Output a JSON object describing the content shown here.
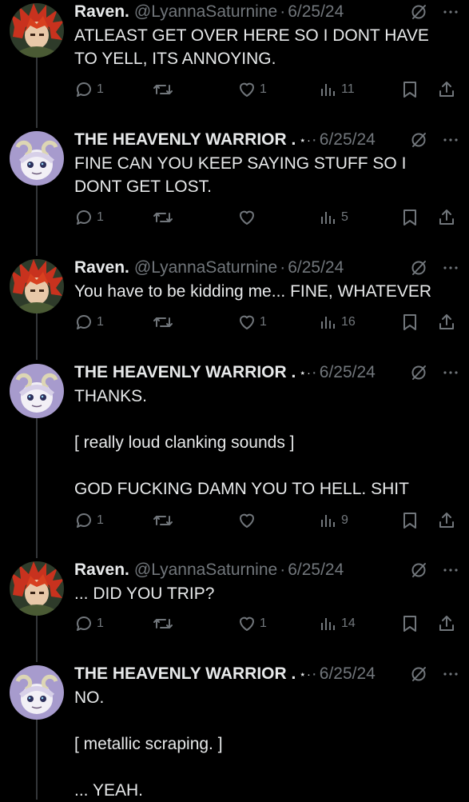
{
  "tweets": [
    {
      "name": "Raven.",
      "badge": "",
      "handle": "@LyannaSaturnine",
      "date": "6/25/24",
      "text": "ATLEAST GET OVER HERE SO I DONT HAVE\nTO YELL, ITS ANNOYING.",
      "replies": "1",
      "retweets": "",
      "likes": "1",
      "views": "11",
      "avatar": "red-hair"
    },
    {
      "name": "THE HEAVENLY WARRIOR .",
      "badge": "⋆·",
      "handle": "",
      "date": "6/25/24",
      "text": "FINE CAN YOU KEEP SAYING STUFF SO I\nDONT GET LOST.",
      "replies": "1",
      "retweets": "",
      "likes": "",
      "views": "5",
      "avatar": "ram-horns"
    },
    {
      "name": "Raven.",
      "badge": "",
      "handle": "@LyannaSaturnine",
      "date": "6/25/24",
      "text": "You have to be kidding me... FINE, WHATEVER",
      "replies": "1",
      "retweets": "",
      "likes": "1",
      "views": "16",
      "avatar": "red-hair"
    },
    {
      "name": "THE HEAVENLY WARRIOR .",
      "badge": "⋆·",
      "handle": "",
      "date": "6/25/24",
      "text": "THANKS.\n\n[ really loud clanking sounds ]\n\nGOD FUCKING DAMN YOU TO HELL. SHIT",
      "replies": "1",
      "retweets": "",
      "likes": "",
      "views": "9",
      "avatar": "ram-horns"
    },
    {
      "name": "Raven.",
      "badge": "",
      "handle": "@LyannaSaturnine",
      "date": "6/25/24",
      "text": "... DID YOU TRIP?",
      "replies": "1",
      "retweets": "",
      "likes": "1",
      "views": "14",
      "avatar": "red-hair"
    },
    {
      "name": "THE HEAVENLY WARRIOR .",
      "badge": "⋆·",
      "handle": "",
      "date": "6/25/24",
      "text": "NO.\n\n[ metallic scraping. ]\n\n... YEAH.",
      "replies": "",
      "retweets": "",
      "likes": "",
      "views": "",
      "avatar": "ram-horns"
    }
  ],
  "icons": {
    "meta_separator": "·",
    "grok": "grok-icon",
    "more": "more-icon",
    "reply": "reply-icon",
    "retweet": "retweet-icon",
    "like": "heart-icon",
    "views": "views-icon",
    "bookmark": "bookmark-icon",
    "share": "share-icon"
  },
  "colors": {
    "background": "#000000",
    "text": "#e7e9ea",
    "muted": "#71767b"
  }
}
